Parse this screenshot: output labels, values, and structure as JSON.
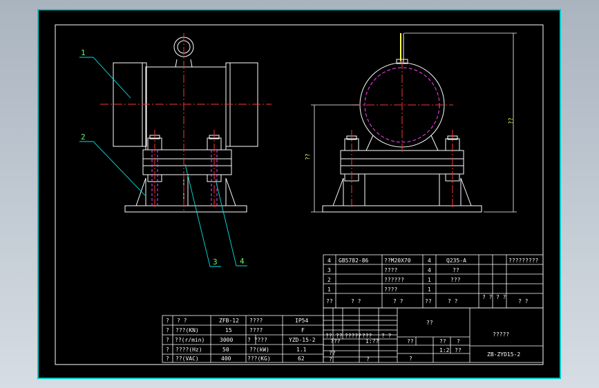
{
  "callouts": [
    "1",
    "2",
    "3",
    "4"
  ],
  "dimension_labels": {
    "front_height": "??",
    "side_height": "??"
  },
  "parts_table": {
    "rows": [
      {
        "no": "4",
        "code": "GB5782-86",
        "name": "??M20X70",
        "qty": "4",
        "material": "Q235-A",
        "note": "?????????"
      },
      {
        "no": "3",
        "code": "",
        "name": "????",
        "qty": "4",
        "material": "??",
        "note": ""
      },
      {
        "no": "2",
        "code": "",
        "name": "??????",
        "qty": "1",
        "material": "???",
        "note": ""
      },
      {
        "no": "1",
        "code": "",
        "name": "????",
        "qty": "1",
        "material": "",
        "note": ""
      }
    ],
    "header": {
      "no": "??",
      "code": "? ?",
      "name": "? ?",
      "qty": "??",
      "material": "? ?",
      "wt1": "? ?",
      "wt2": "? ?",
      "note": "? ?"
    }
  },
  "spec_table": {
    "rows": [
      {
        "k1": "? ?",
        "v1": "ZFB-12",
        "k2": "????",
        "v2": "IP54"
      },
      {
        "k1": "???(KN)",
        "v1": "15",
        "k2": "????",
        "v2": "F"
      },
      {
        "k1": "??(r/min)",
        "v1": "3000",
        "k2": "? ????",
        "v2": "YZD-15-2"
      },
      {
        "k1": "????(Hz)",
        "v1": "50",
        "k2": "??(kW)",
        "v2": "1.1"
      },
      {
        "k1": "??(VAC)",
        "v1": "400",
        "k2": "???(KG)",
        "v2": "62"
      }
    ],
    "side_labels": [
      "?",
      "?",
      "?",
      "?",
      "?"
    ]
  },
  "title_block": {
    "drawing_name": "??",
    "company": "?????",
    "drawing_no": "ZB-ZYD15-2",
    "small_texts": [
      "??",
      "??",
      "?????",
      "???",
      "? ?",
      "???",
      "1:??",
      "??",
      "??",
      "?",
      "1:2",
      "??",
      "??",
      "?",
      "?",
      "?"
    ]
  },
  "colors": {
    "background": "#000000",
    "frame": "#ffffff",
    "outline": "#ffffff",
    "centerline": "#ff3333",
    "hidden": "#ff44ff",
    "leader": "#00e5e5",
    "text_green": "#66ff66",
    "text_yellow": "#ffff55",
    "border_cyan": "#00c8c8"
  }
}
